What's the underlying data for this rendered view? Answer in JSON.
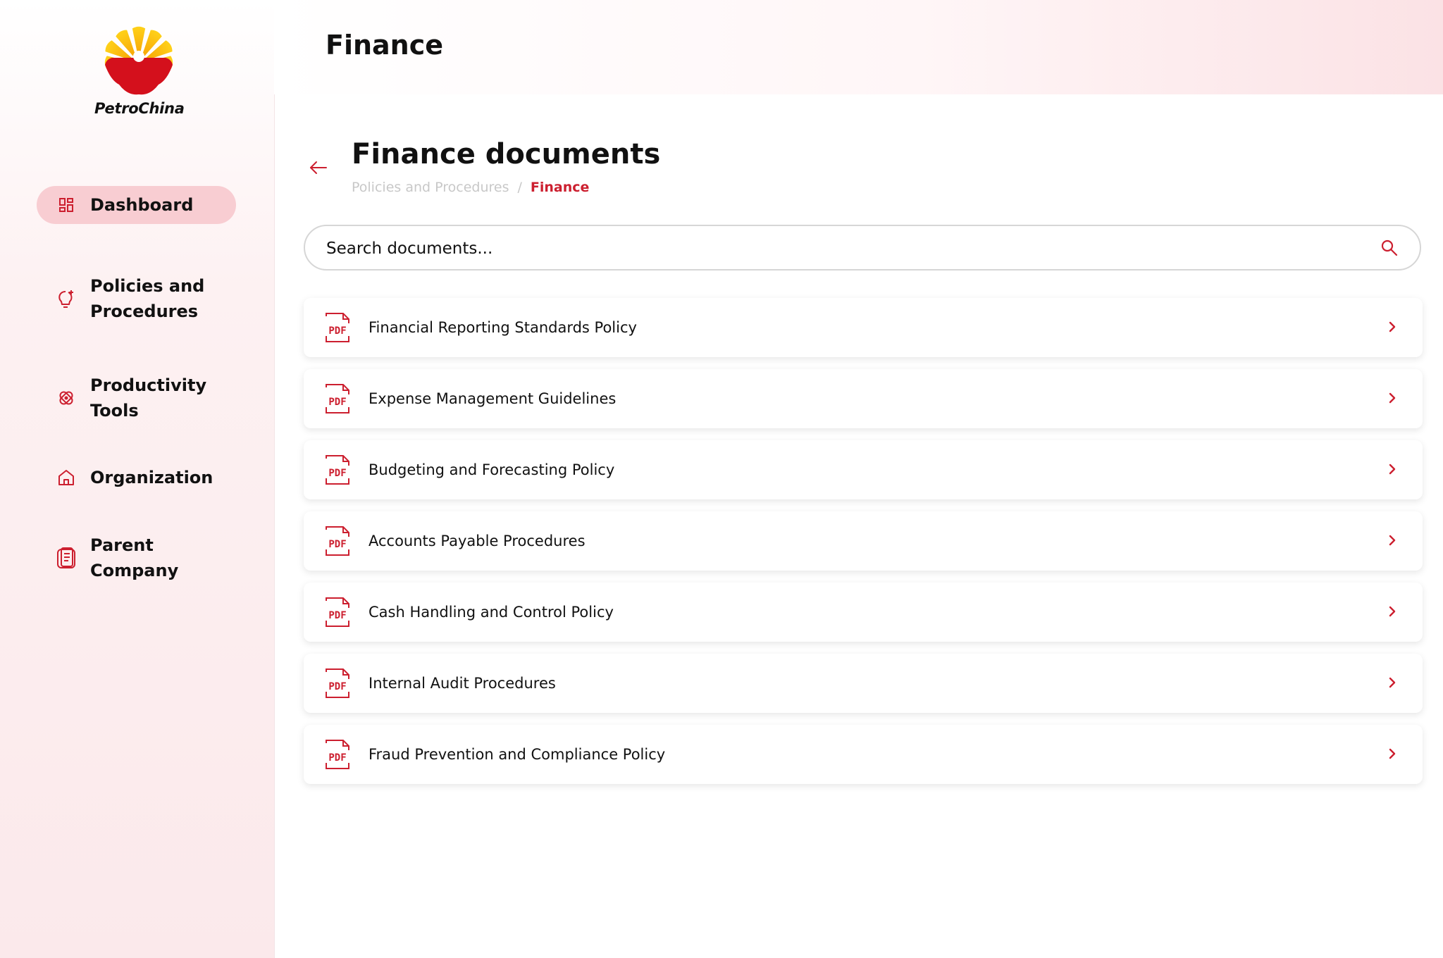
{
  "brand": {
    "name": "PetroChina",
    "accent": "#cc1f2f",
    "active_nav_bg": "#f8cdd2"
  },
  "sidebar": {
    "items": [
      {
        "label": "Dashboard",
        "icon": "dashboard-icon",
        "active": true
      },
      {
        "label_lines": [
          "Policies and",
          "Procedures"
        ],
        "icon": "lightbulb-icon"
      },
      {
        "label_lines": [
          "Productivity",
          "Tools"
        ],
        "icon": "tools-icon"
      },
      {
        "label": "Organization",
        "icon": "home-icon"
      },
      {
        "label_lines": [
          "Parent",
          "Company"
        ],
        "icon": "document-icon"
      }
    ]
  },
  "header": {
    "title": "Finance"
  },
  "main": {
    "title": "Finance documents",
    "breadcrumb": {
      "parent": "Policies and Procedures",
      "separator": "/",
      "current": "Finance"
    },
    "search": {
      "placeholder": "Search documents..."
    },
    "documents": [
      {
        "title": "Financial Reporting Standards Policy",
        "type": "PDF"
      },
      {
        "title": "Expense Management Guidelines",
        "type": "PDF"
      },
      {
        "title": "Budgeting and Forecasting Policy",
        "type": "PDF"
      },
      {
        "title": "Accounts Payable Procedures",
        "type": "PDF"
      },
      {
        "title": "Cash Handling and Control Policy",
        "type": "PDF"
      },
      {
        "title": "Internal Audit Procedures",
        "type": "PDF"
      },
      {
        "title": "Fraud Prevention and Compliance Policy",
        "type": "PDF"
      }
    ]
  }
}
